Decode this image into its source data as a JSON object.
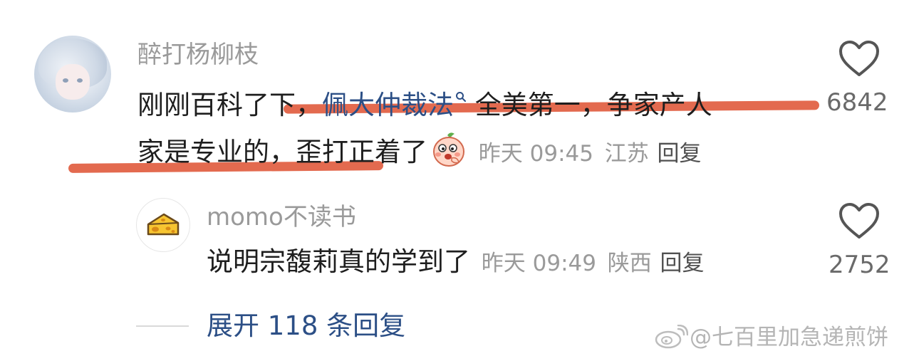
{
  "main_comment": {
    "username": "醉打杨柳枝",
    "text_before_link": "刚刚百科了下，",
    "link_text": "佩大仲裁法",
    "link_icon": "search-icon",
    "text_after_link": "全美第一，争家产人",
    "line2_text": "家是专业的，歪打正着了",
    "emoji": "peach-face-emoji",
    "time": "昨天 09:45",
    "location": "江苏",
    "reply_label": "回复",
    "like_count": "6842"
  },
  "reply_comment": {
    "username": "momo不读书",
    "text": "说明宗馥莉真的学到了",
    "time": "昨天 09:49",
    "location": "陕西",
    "reply_label": "回复",
    "like_count": "2752"
  },
  "expand_label": "展开 118 条回复",
  "watermark": "@七百里加急递煎饼",
  "colors": {
    "link": "#2c4f86",
    "highlight": "#e05a3c",
    "meta": "#9a9a9a"
  }
}
